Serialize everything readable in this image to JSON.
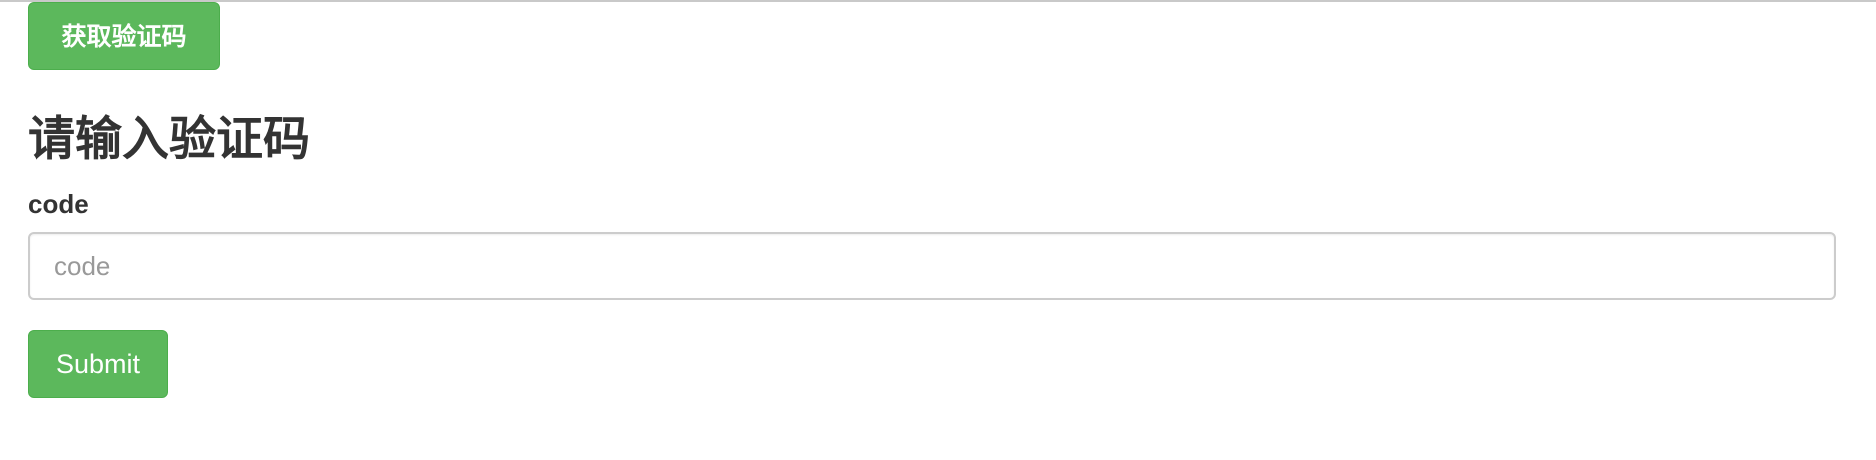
{
  "actions": {
    "get_code_label": "获取验证码"
  },
  "form": {
    "heading": "请输入验证码",
    "code_label": "code",
    "code_value": "",
    "code_placeholder": "code",
    "submit_label": "Submit"
  },
  "colors": {
    "button_green": "#5cb85c",
    "button_border": "#4cae4c",
    "text_dark": "#333333",
    "input_border": "#cccccc",
    "placeholder": "#999999"
  }
}
